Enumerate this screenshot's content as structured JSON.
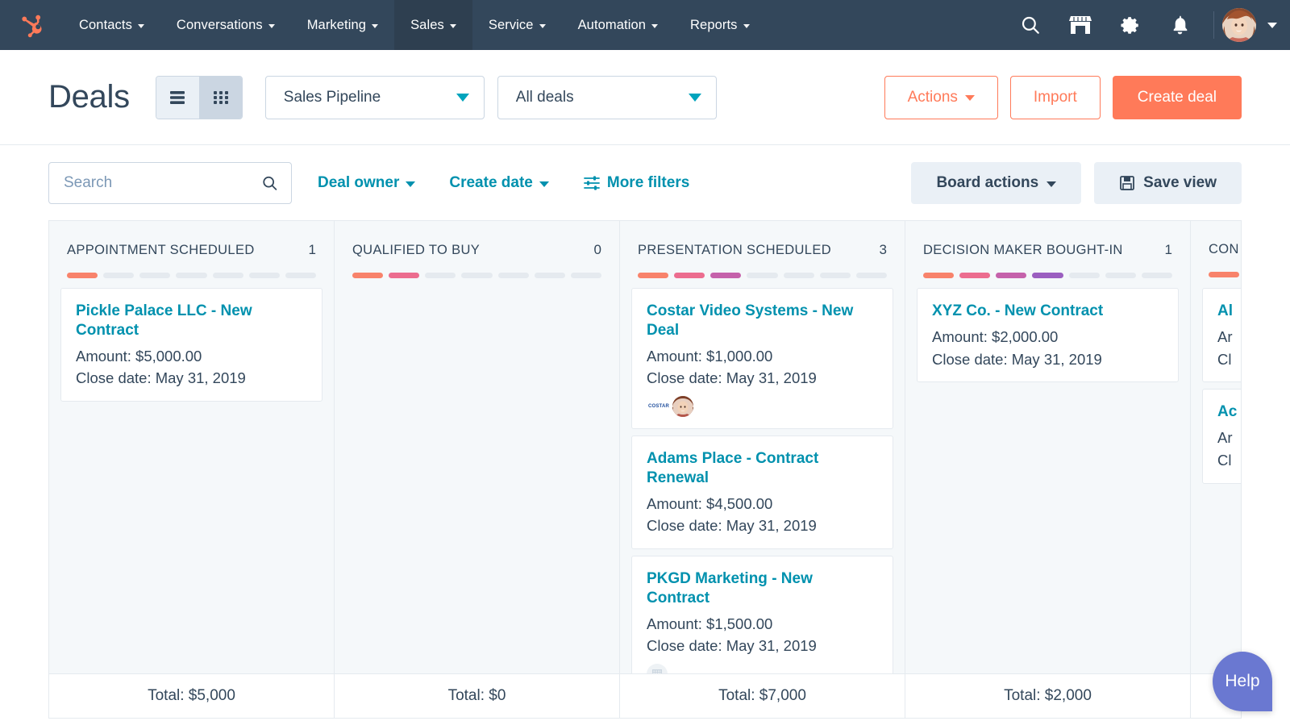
{
  "topnav": {
    "logo_icon": "hubspot-sprocket-logo",
    "items": [
      {
        "label": "Contacts",
        "active": false
      },
      {
        "label": "Conversations",
        "active": false
      },
      {
        "label": "Marketing",
        "active": false
      },
      {
        "label": "Sales",
        "active": true
      },
      {
        "label": "Service",
        "active": false
      },
      {
        "label": "Automation",
        "active": false
      },
      {
        "label": "Reports",
        "active": false
      }
    ],
    "icons": [
      "search-icon",
      "marketplace-icon",
      "gear-icon",
      "bell-icon"
    ]
  },
  "header": {
    "title": "Deals",
    "view_toggle": {
      "list_icon": "list-view-icon",
      "board_icon": "board-view-icon",
      "selected": "board"
    },
    "pipeline_select": "Sales Pipeline",
    "view_select": "All deals",
    "actions_label": "Actions",
    "import_label": "Import",
    "create_label": "Create deal"
  },
  "filterbar": {
    "search_placeholder": "Search",
    "search_value": "",
    "search_icon": "search-icon",
    "deal_owner_label": "Deal owner",
    "create_date_label": "Create date",
    "more_filters_label": "More filters",
    "more_filters_icon": "filter-sliders-icon",
    "board_actions_label": "Board actions",
    "save_view_label": "Save view",
    "save_icon": "floppy-disk-icon"
  },
  "board": {
    "segment_count": 7,
    "segment_colors": [
      "#f8836b",
      "#ec6d8f",
      "#c562ab",
      "#9b5fc0",
      "#7a5fd1",
      "#5f6ed1",
      "#4f7ad1"
    ],
    "segment_empty_color": "#e5eaef",
    "columns": [
      {
        "title": "APPOINTMENT SCHEDULED",
        "count": "1",
        "filled": 1,
        "total_label": "Total: $5,000",
        "cards": [
          {
            "title": "Pickle Palace LLC - New Contract",
            "amount": "Amount: $5,000.00",
            "close_date": "Close date: May 31, 2019",
            "icons": []
          }
        ]
      },
      {
        "title": "QUALIFIED TO BUY",
        "count": "0",
        "filled": 2,
        "total_label": "Total: $0",
        "cards": []
      },
      {
        "title": "PRESENTATION SCHEDULED",
        "count": "3",
        "filled": 3,
        "total_label": "Total: $7,000",
        "cards": [
          {
            "title": "Costar Video Systems - New Deal",
            "amount": "Amount: $1,000.00",
            "close_date": "Close date: May 31, 2019",
            "icons": [
              "company-logo-costar",
              "contact-avatar"
            ],
            "logo_text": "COSTAR"
          },
          {
            "title": "Adams Place - Contract Renewal",
            "amount": "Amount: $4,500.00",
            "close_date": "Close date: May 31, 2019",
            "icons": []
          },
          {
            "title": "PKGD Marketing - New Contract",
            "amount": "Amount: $1,500.00",
            "close_date": "Close date: May 31, 2019",
            "icons": [
              "company-placeholder"
            ]
          }
        ]
      },
      {
        "title": "DECISION MAKER BOUGHT-IN",
        "count": "1",
        "filled": 4,
        "total_label": "Total: $2,000",
        "cards": [
          {
            "title": "XYZ Co. - New Contract",
            "amount": "Amount: $2,000.00",
            "close_date": "Close date: May 31, 2019",
            "icons": []
          }
        ]
      },
      {
        "title": "CON",
        "count": "",
        "filled": 1,
        "total_label": "",
        "cards": [
          {
            "title": "Al",
            "amount": "Ar",
            "close_date": "Cl",
            "icons": []
          },
          {
            "title": "Ac",
            "amount": "Ar",
            "close_date": "Cl",
            "icons": []
          }
        ]
      }
    ]
  },
  "help": {
    "label": "Help"
  },
  "colors": {
    "nav_bg": "#33475b",
    "accent_orange": "#ff7a59",
    "link_teal": "#0091ae",
    "help_purple": "#6a78d1"
  }
}
